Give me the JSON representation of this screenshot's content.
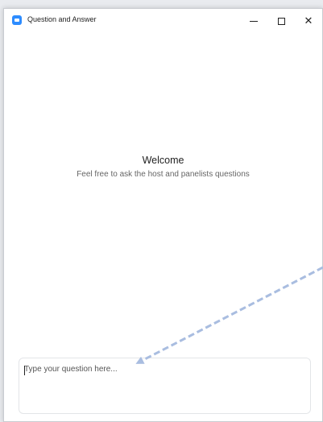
{
  "window": {
    "title": "Question and Answer",
    "accent_color": "#2d8cff",
    "controls": {
      "minimize_icon": "minimize-icon",
      "maximize_icon": "maximize-icon",
      "close_icon": "close-icon"
    }
  },
  "welcome": {
    "title": "Welcome",
    "subtitle": "Feel free to ask the host and panelists questions"
  },
  "question_input": {
    "placeholder": "Type your question here...",
    "value": ""
  },
  "annotation": {
    "arrow_color": "#a9bde0"
  }
}
